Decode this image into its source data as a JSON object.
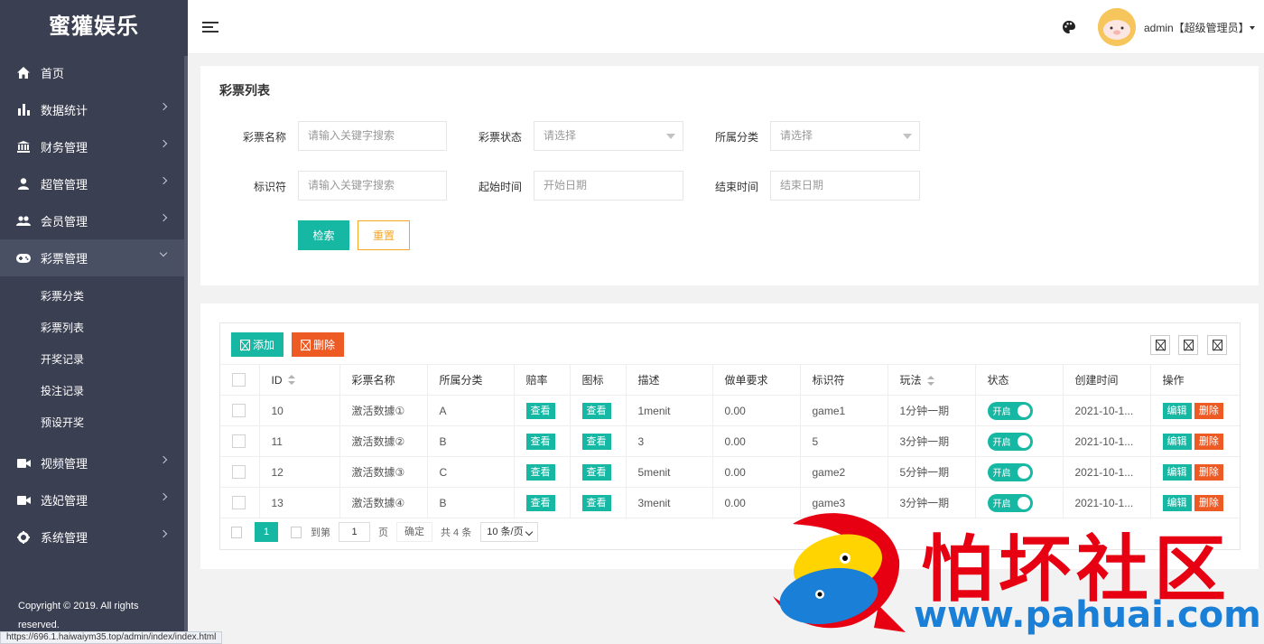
{
  "sidebar": {
    "brand": "蜜獾娱乐",
    "menu": [
      {
        "label": "首页",
        "icon": "home-icon"
      },
      {
        "label": "数据统计",
        "icon": "bar-chart-icon"
      },
      {
        "label": "财务管理",
        "icon": "bank-icon"
      },
      {
        "label": "超管管理",
        "icon": "user-icon"
      },
      {
        "label": "会员管理",
        "icon": "users-icon"
      },
      {
        "label": "彩票管理",
        "icon": "gamepad-icon"
      }
    ],
    "submenu": [
      "彩票分类",
      "彩票列表",
      "开奖记录",
      "投注记录",
      "预设开奖"
    ],
    "menu_after": [
      {
        "label": "视频管理",
        "icon": "video-camera-icon"
      },
      {
        "label": "选妃管理",
        "icon": "video-camera-icon"
      },
      {
        "label": "系统管理",
        "icon": "gear-icon"
      }
    ],
    "copyright": "Copyright © 2019. All rights reserved."
  },
  "header": {
    "user_label": "admin【超级管理员】"
  },
  "search": {
    "title": "彩票列表",
    "name_label": "彩票名称",
    "name_placeholder": "请输入关键字搜索",
    "status_label": "彩票状态",
    "status_placeholder": "请选择",
    "category_label": "所属分类",
    "category_placeholder": "请选择",
    "identifier_label": "标识符",
    "identifier_placeholder": "请输入关键字搜索",
    "start_label": "起始时间",
    "start_placeholder": "开始日期",
    "end_label": "结束时间",
    "end_placeholder": "结束日期",
    "search_btn": "检索",
    "reset_btn": "重置"
  },
  "table": {
    "add_btn": "添加",
    "delete_btn": "删除",
    "columns": [
      "ID",
      "彩票名称",
      "所属分类",
      "赔率",
      "图标",
      "描述",
      "做单要求",
      "标识符",
      "玩法",
      "状态",
      "创建时间",
      "操作"
    ],
    "view_label": "查看",
    "status_on": "开启",
    "edit_label": "编辑",
    "delete_label": "删除",
    "rows": [
      {
        "id": "10",
        "name": "激活数據①",
        "category": "A",
        "desc": "1menit",
        "req": "0.00",
        "ident": "game1",
        "play": "1分钟一期",
        "created": "2021-10-1..."
      },
      {
        "id": "11",
        "name": "激活数據②",
        "category": "B",
        "desc": "3",
        "req": "0.00",
        "ident": "5",
        "play": "3分钟一期",
        "created": "2021-10-1..."
      },
      {
        "id": "12",
        "name": "激活数據③",
        "category": "C",
        "desc": "5menit",
        "req": "0.00",
        "ident": "game2",
        "play": "5分钟一期",
        "created": "2021-10-1..."
      },
      {
        "id": "13",
        "name": "激活数據④",
        "category": "B",
        "desc": "3menit",
        "req": "0.00",
        "ident": "game3",
        "play": "3分钟一期",
        "created": "2021-10-1..."
      }
    ]
  },
  "pager": {
    "current": "1",
    "goto_label": "到第",
    "goto_value": "1",
    "page_label": "页",
    "confirm": "确定",
    "total": "共 4 条",
    "page_size": "10 条/页"
  },
  "statusbar": "https://696.1.haiwaiym35.top/admin/index/index.html",
  "watermark": {
    "title": "怕坏社区",
    "url": "www.pahuai.com"
  },
  "colors": {
    "sidebar_bg": "#3a3f51",
    "primary": "#16b8a4",
    "danger": "#ee5a24",
    "warning": "#f5a623"
  }
}
